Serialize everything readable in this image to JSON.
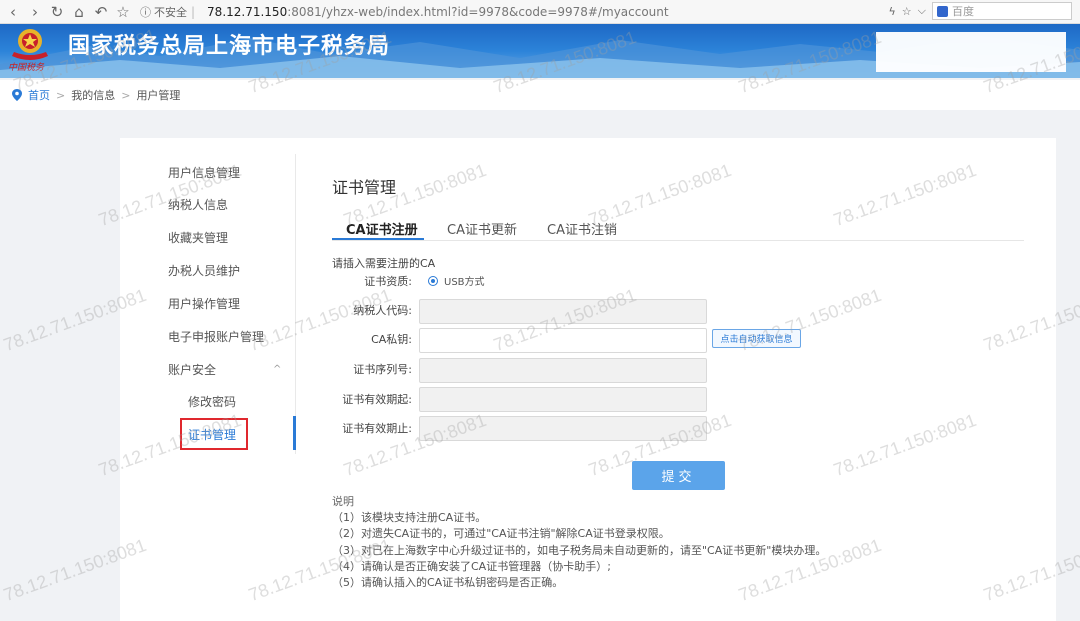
{
  "browser": {
    "security_label": "不安全",
    "url_host": "78.12.71.150",
    "url_rest": ":8081/yhzx-web/index.html?id=9978&code=9978#/myaccount",
    "search_placeholder": "百度"
  },
  "header": {
    "site_title": "国家税务总局上海市电子税务局",
    "logo_text": "中国税务"
  },
  "breadcrumb": {
    "home": "首页",
    "items": [
      "我的信息",
      "用户管理"
    ],
    "separator": ">"
  },
  "sidebar": {
    "items": [
      {
        "label": "用户信息管理"
      },
      {
        "label": "纳税人信息"
      },
      {
        "label": "收藏夹管理"
      },
      {
        "label": "办税人员维护"
      },
      {
        "label": "用户操作管理"
      },
      {
        "label": "电子申报账户管理"
      },
      {
        "label": "账户安全"
      }
    ],
    "sub_items": [
      {
        "label": "修改密码"
      },
      {
        "label": "证书管理"
      }
    ]
  },
  "content": {
    "page_title": "证书管理",
    "tabs": [
      "CA证书注册",
      "CA证书更新",
      "CA证书注销"
    ],
    "hint": "请插入需要注册的CA",
    "form": {
      "cert_type_label": "证书资质:",
      "cert_type_value": "USB方式",
      "taxpayer_code_label": "纳税人代码:",
      "ca_key_label": "CA私钥:",
      "serial_label": "证书序列号:",
      "valid_from_label": "证书有效期起:",
      "valid_to_label": "证书有效期止:",
      "auto_fetch_button": "点击自动获取信息",
      "submit_button": "提交"
    },
    "notes": {
      "title": "说明",
      "lines": [
        "（1）该模块支持注册CA证书。",
        "（2）对遗失CA证书的，可通过\"CA证书注销\"解除CA证书登录权限。",
        "（3）对已在上海数字中心升级过证书的，如电子税务局未自动更新的，请至\"CA证书更新\"模块办理。",
        "（4）请确认是否正确安装了CA证书管理器（协卡助手）;",
        "（5）请确认插入的CA证书私钥密码是否正确。"
      ]
    }
  },
  "watermark": "78.12.71.150:8081",
  "colors": {
    "accent": "#2a7ad6",
    "header_blue": "#1e69c5",
    "highlight_red": "#e0282e",
    "submit_blue": "#5ba4ea"
  }
}
